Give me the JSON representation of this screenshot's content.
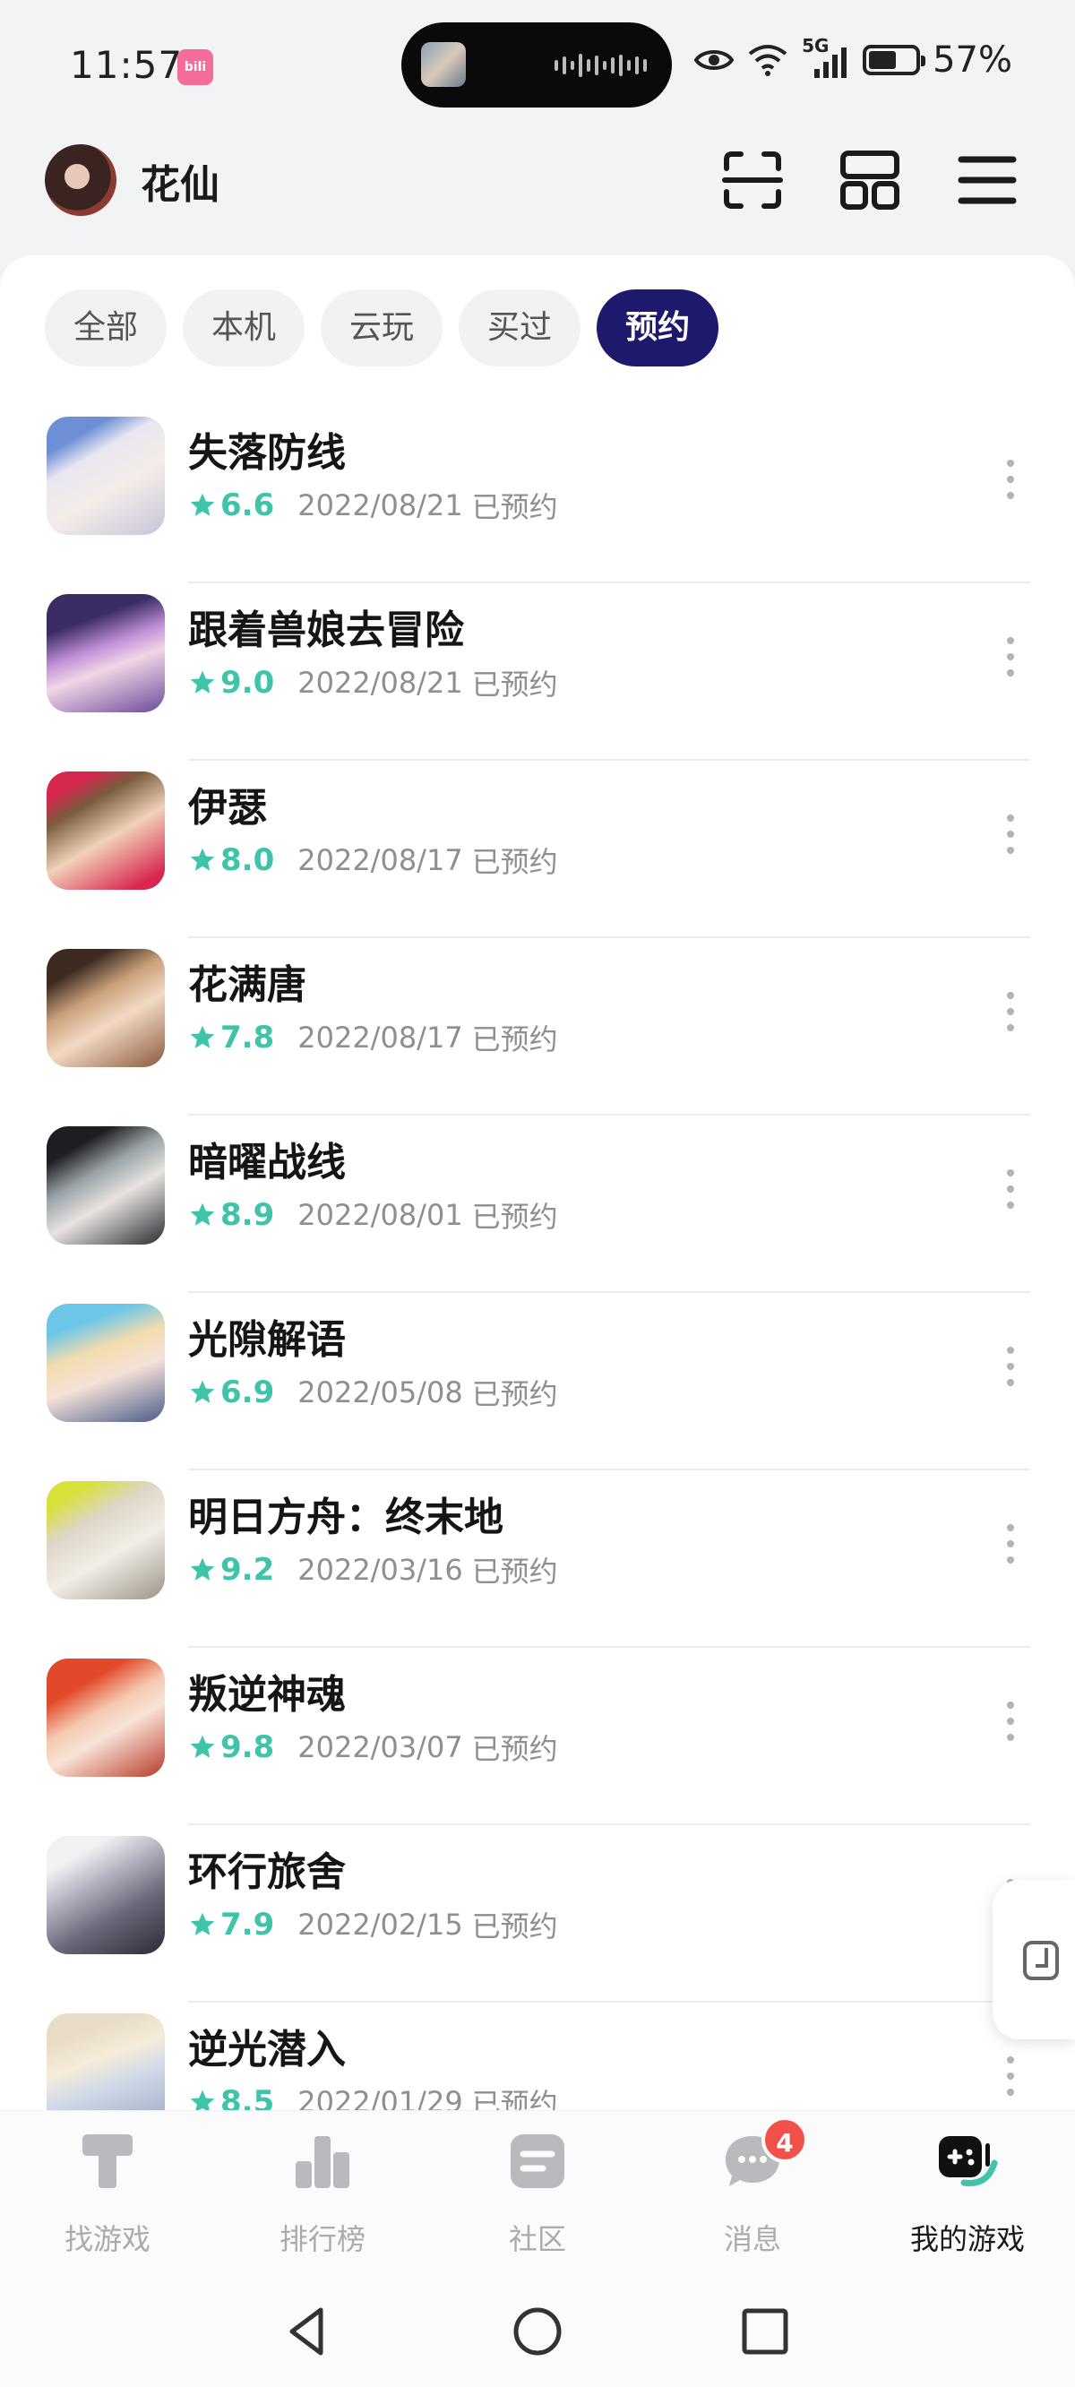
{
  "status_bar": {
    "time": "11:57",
    "app_badge": "bilibili",
    "network": "5G",
    "battery": "57%"
  },
  "header": {
    "user_name": "花仙"
  },
  "tabs": [
    {
      "label": "全部",
      "active": false
    },
    {
      "label": "本机",
      "active": false
    },
    {
      "label": "云玩",
      "active": false
    },
    {
      "label": "买过",
      "active": false
    },
    {
      "label": "预约",
      "active": true
    }
  ],
  "games": [
    {
      "title": "失落防线",
      "rating": "6.6",
      "date": "2022/08/21",
      "status": "已预约"
    },
    {
      "title": "跟着兽娘去冒险",
      "rating": "9.0",
      "date": "2022/08/21",
      "status": "已预约"
    },
    {
      "title": "伊瑟",
      "rating": "8.0",
      "date": "2022/08/17",
      "status": "已预约"
    },
    {
      "title": "花满唐",
      "rating": "7.8",
      "date": "2022/08/17",
      "status": "已预约"
    },
    {
      "title": "暗曜战线",
      "rating": "8.9",
      "date": "2022/08/01",
      "status": "已预约"
    },
    {
      "title": "光隙解语",
      "rating": "6.9",
      "date": "2022/05/08",
      "status": "已预约"
    },
    {
      "title": "明日方舟：终末地",
      "rating": "9.2",
      "date": "2022/03/16",
      "status": "已预约"
    },
    {
      "title": "叛逆神魂",
      "rating": "9.8",
      "date": "2022/03/07",
      "status": "已预约"
    },
    {
      "title": "环行旅舍",
      "rating": "7.9",
      "date": "2022/02/15",
      "status": "已预约"
    },
    {
      "title": "逆光潜入",
      "rating": "8.5",
      "date": "2022/01/29",
      "status": "已预约"
    }
  ],
  "bottom_nav": [
    {
      "label": "找游戏",
      "icon": "find-game-icon",
      "active": false
    },
    {
      "label": "排行榜",
      "icon": "ranking-icon",
      "active": false
    },
    {
      "label": "社区",
      "icon": "community-icon",
      "active": false
    },
    {
      "label": "消息",
      "icon": "message-icon",
      "active": false,
      "badge": "4"
    },
    {
      "label": "我的游戏",
      "icon": "my-games-icon",
      "active": true
    }
  ],
  "colors": {
    "accent": "#1d1a6e",
    "rating": "#3fc3a9",
    "badge": "#f2514a"
  }
}
